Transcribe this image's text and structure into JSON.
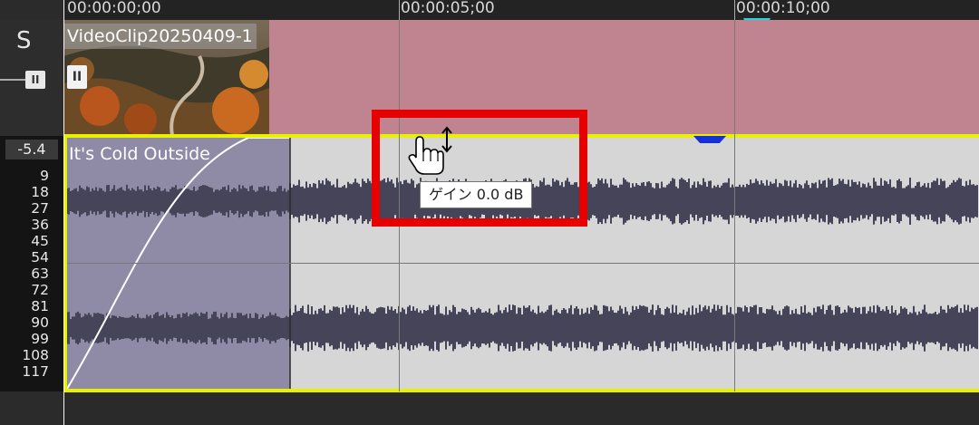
{
  "ruler": {
    "timecodes": [
      "00:00:00;00",
      "00:00:05;00",
      "00:00:10;00"
    ]
  },
  "left_panel": {
    "solo_label": "S",
    "slider_icon": "II",
    "level_readout": "-5.4",
    "meter_scale": [
      "9",
      "18",
      "27",
      "36",
      "45",
      "54",
      "63",
      "72",
      "81",
      "90",
      "99",
      "108",
      "117"
    ]
  },
  "video_track": {
    "clip_title": "VideoClip20250409-1",
    "pause_icon_text": "II",
    "color": "#c08390"
  },
  "audio_track": {
    "clip_title": "It's Cold Outside",
    "border_color": "#e8f200",
    "fade_color": "#8f8aa6",
    "body_color": "#d6d6d6"
  },
  "tooltip": {
    "text": "ゲイン 0.0 dB"
  },
  "icons": {
    "cursor": "hand-pointer-icon",
    "resize": "vertical-resize-icon"
  },
  "highlight_color": "#e60000"
}
